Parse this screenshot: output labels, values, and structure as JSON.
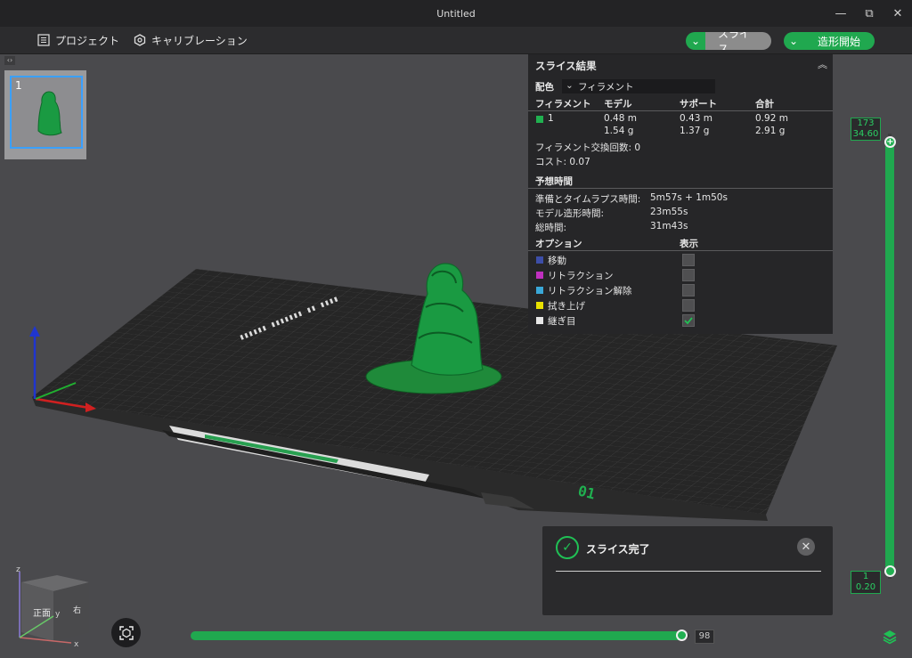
{
  "window": {
    "title": "Untitled",
    "minimize": "—",
    "restore": "⧉",
    "close": "✕"
  },
  "menu": {
    "project": "プロジェクト",
    "calibration": "キャリブレーション"
  },
  "toolbar": {
    "slice": "スライス",
    "print": "造形開始"
  },
  "plates": [
    {
      "number": "1"
    }
  ],
  "plate_label": "01",
  "results": {
    "title": "スライス結果",
    "color_label": "配色",
    "color_value": "フィラメント",
    "headers": {
      "filament": "フィラメント",
      "model": "モデル",
      "support": "サポート",
      "total": "合計"
    },
    "rows": [
      {
        "id": "1",
        "model_m": "0.48 m",
        "model_g": "1.54 g",
        "support_m": "0.43 m",
        "support_g": "1.37 g",
        "total_m": "0.92 m",
        "total_g": "2.91 g",
        "color": "#20b050"
      }
    ],
    "swaps": "フィラメント交換回数: 0",
    "cost": "コスト: 0.07",
    "time_title": "予想時間",
    "prep_label": "準備とタイムラプス時間:",
    "prep_value": "5m57s + 1m50s",
    "model_time_label": "モデル造形時間:",
    "model_time_value": "23m55s",
    "total_time_label": "総時間:",
    "total_time_value": "31m43s",
    "options_title": "オプション",
    "display_title": "表示",
    "options": [
      {
        "label": "移動",
        "color": "#3d4ea8",
        "checked": false
      },
      {
        "label": "リトラクション",
        "color": "#c030c0",
        "checked": false
      },
      {
        "label": "リトラクション解除",
        "color": "#3aa8d8",
        "checked": false
      },
      {
        "label": "拭き上げ",
        "color": "#e8e000",
        "checked": false
      },
      {
        "label": "継ぎ目",
        "color": "#e8e8e8",
        "checked": true
      }
    ]
  },
  "layer_slider": {
    "top_layer": "173",
    "top_height": "34.60",
    "bottom_layer": "1",
    "bottom_height": "0.20"
  },
  "move_slider": {
    "value": "98"
  },
  "toast": {
    "message": "スライス完了"
  },
  "view_cube": {
    "face": "正面",
    "right_face": "右",
    "axis_x": "x",
    "axis_y": "y",
    "axis_z": "z"
  }
}
